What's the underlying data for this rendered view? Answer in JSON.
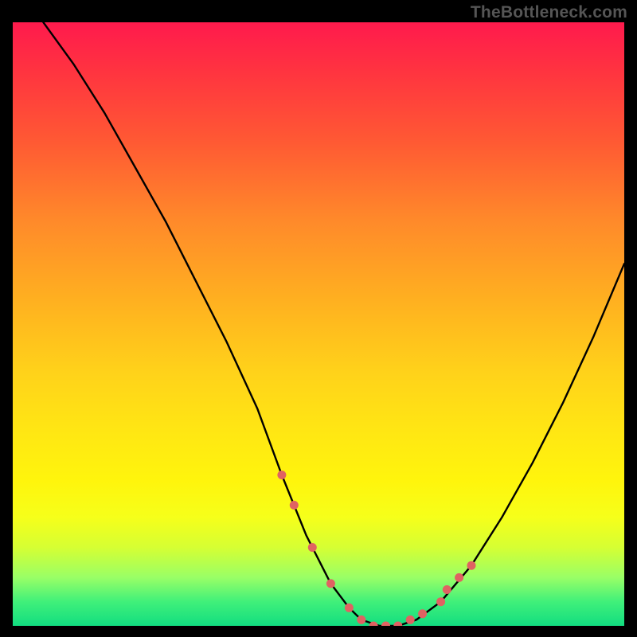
{
  "watermark": "TheBottleneck.com",
  "chart_data": {
    "type": "line",
    "title": "",
    "xlabel": "",
    "ylabel": "",
    "xlim": [
      0,
      100
    ],
    "ylim": [
      0,
      100
    ],
    "series": [
      {
        "name": "curve",
        "x": [
          5,
          10,
          15,
          20,
          25,
          30,
          35,
          40,
          44,
          48,
          52,
          55,
          57,
          60,
          63,
          66,
          70,
          75,
          80,
          85,
          90,
          95,
          100
        ],
        "y": [
          100,
          93,
          85,
          76,
          67,
          57,
          47,
          36,
          25,
          15,
          7,
          3,
          1,
          0,
          0,
          1,
          4,
          10,
          18,
          27,
          37,
          48,
          60
        ]
      }
    ],
    "markers": {
      "name": "highlight-dots",
      "color": "#e06262",
      "x": [
        44,
        46,
        49,
        52,
        55,
        57,
        59,
        61,
        63,
        65,
        67,
        70,
        71,
        73,
        75
      ],
      "y": [
        25,
        20,
        13,
        7,
        3,
        1,
        0,
        0,
        0,
        1,
        2,
        4,
        6,
        8,
        10
      ]
    },
    "gradient_stops": [
      {
        "pct": 0,
        "color": "#ff1a4d"
      },
      {
        "pct": 20,
        "color": "#ff5a33"
      },
      {
        "pct": 46,
        "color": "#ffb020"
      },
      {
        "pct": 76,
        "color": "#fff50c"
      },
      {
        "pct": 92,
        "color": "#99ff66"
      },
      {
        "pct": 100,
        "color": "#12dd80"
      }
    ]
  }
}
